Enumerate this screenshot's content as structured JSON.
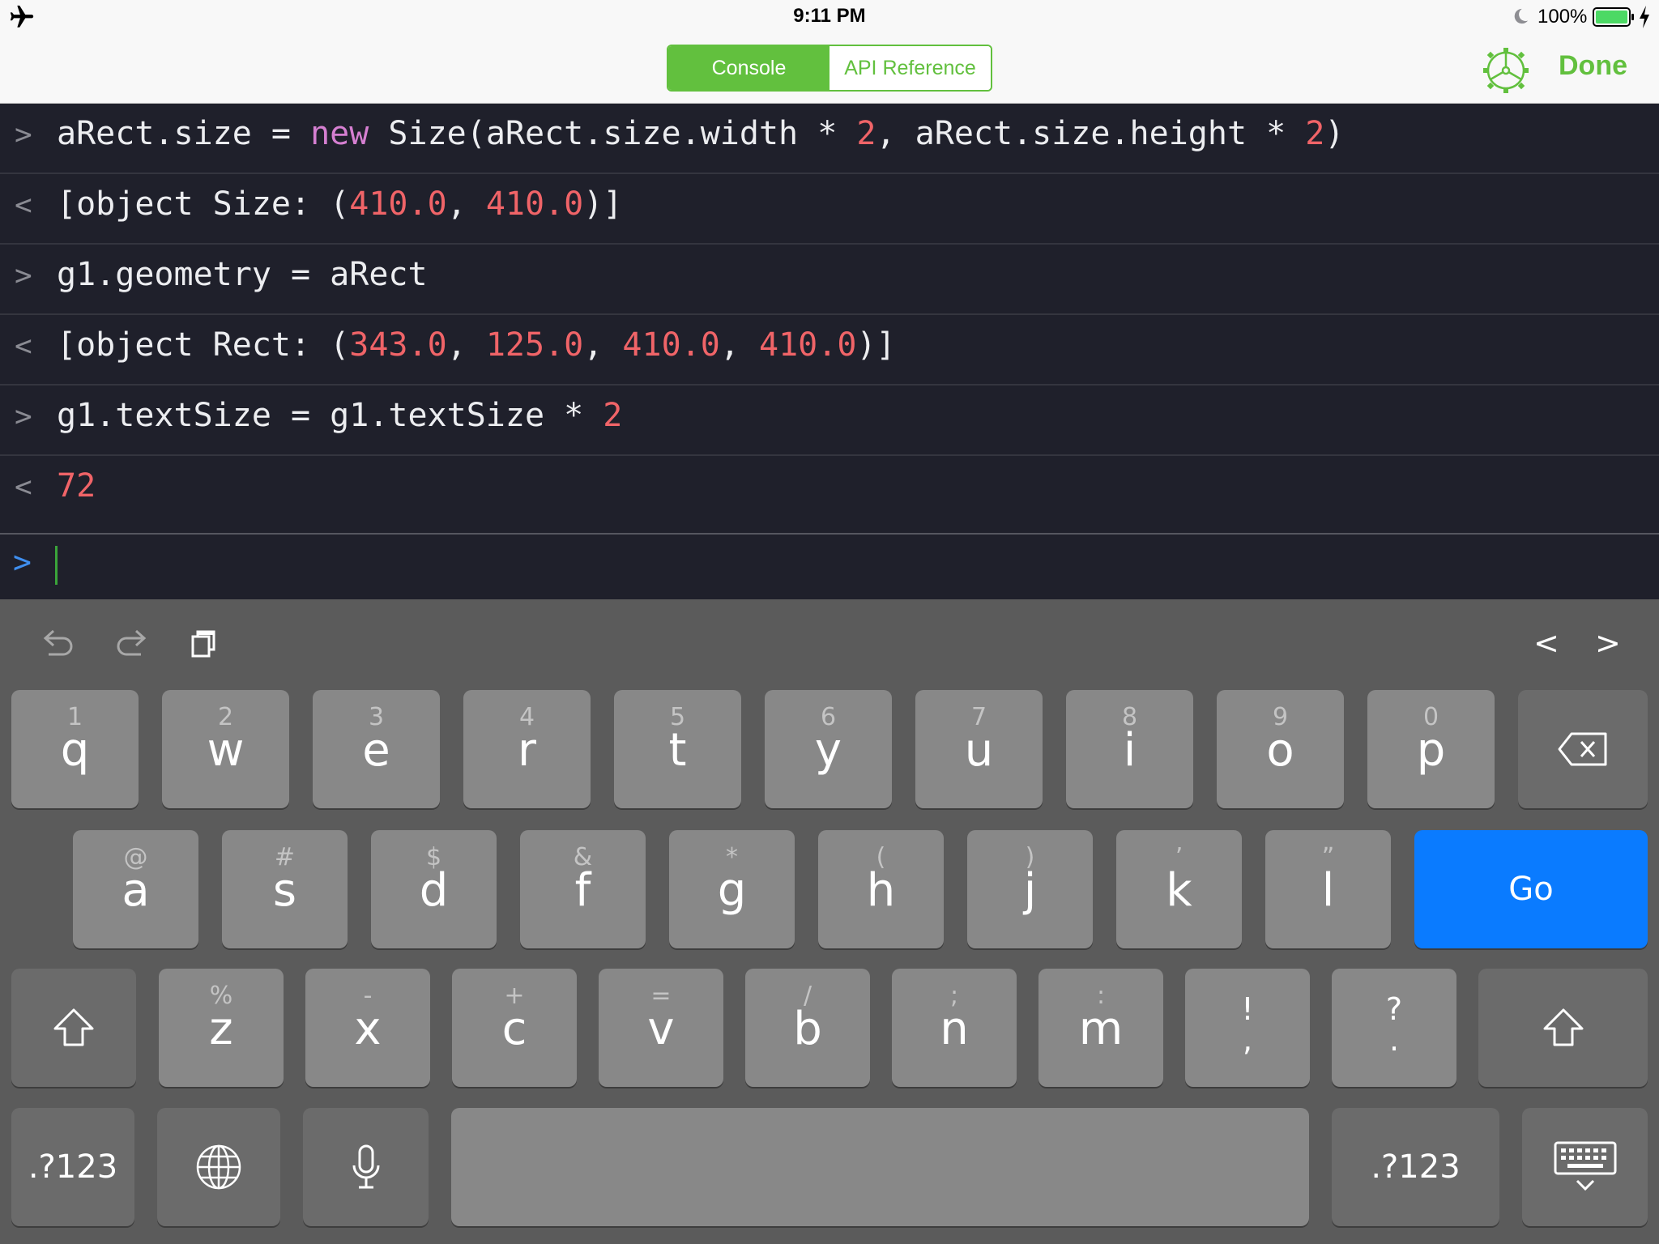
{
  "status_bar": {
    "time": "9:11 PM",
    "battery_percent": "100%",
    "airplane_mode": true,
    "do_not_disturb": true,
    "charging": true
  },
  "nav": {
    "tabs": [
      {
        "label": "Console",
        "selected": true
      },
      {
        "label": "API Reference",
        "selected": false
      }
    ],
    "settings_icon": "gear-icon",
    "done_label": "Done"
  },
  "console": {
    "lines": [
      {
        "marker": ">",
        "kind": "input",
        "tokens": [
          {
            "t": "aRect.size = ",
            "c": "txt"
          },
          {
            "t": "new",
            "c": "kw"
          },
          {
            "t": " Size(aRect.size.width * ",
            "c": "txt"
          },
          {
            "t": "2",
            "c": "num"
          },
          {
            "t": ", aRect.size.height * ",
            "c": "txt"
          },
          {
            "t": "2",
            "c": "num"
          },
          {
            "t": ")",
            "c": "txt"
          }
        ]
      },
      {
        "marker": "<",
        "kind": "output",
        "tokens": [
          {
            "t": "[object Size: (",
            "c": "txt"
          },
          {
            "t": "410.0",
            "c": "num"
          },
          {
            "t": ", ",
            "c": "txt"
          },
          {
            "t": "410.0",
            "c": "num"
          },
          {
            "t": ")]",
            "c": "txt"
          }
        ]
      },
      {
        "marker": ">",
        "kind": "input",
        "tokens": [
          {
            "t": "g1.geometry = aRect",
            "c": "txt"
          }
        ]
      },
      {
        "marker": "<",
        "kind": "output",
        "tokens": [
          {
            "t": "[object Rect: (",
            "c": "txt"
          },
          {
            "t": "343.0",
            "c": "num"
          },
          {
            "t": ", ",
            "c": "txt"
          },
          {
            "t": "125.0",
            "c": "num"
          },
          {
            "t": ", ",
            "c": "txt"
          },
          {
            "t": "410.0",
            "c": "num"
          },
          {
            "t": ", ",
            "c": "txt"
          },
          {
            "t": "410.0",
            "c": "num"
          },
          {
            "t": ")]",
            "c": "txt"
          }
        ]
      },
      {
        "marker": ">",
        "kind": "input",
        "tokens": [
          {
            "t": "g1.textSize = g1.textSize * ",
            "c": "txt"
          },
          {
            "t": "2",
            "c": "num"
          }
        ]
      },
      {
        "marker": "<",
        "kind": "output",
        "tokens": [
          {
            "t": "72",
            "c": "num"
          }
        ]
      }
    ],
    "prompt_marker": ">",
    "input_value": ""
  },
  "colors": {
    "accent_green": "#62c03e",
    "console_bg": "#1f202b",
    "number": "#f06468",
    "keyword": "#d57fd1",
    "prompt_blue": "#3f8ff0",
    "go_blue": "#0a7bff"
  },
  "keyboard": {
    "toolbar": {
      "undo_icon": "undo-icon",
      "redo_icon": "redo-icon",
      "paste_icon": "paste-icon",
      "prev_label": "<",
      "next_label": ">"
    },
    "row1": [
      {
        "alt": "1",
        "main": "q"
      },
      {
        "alt": "2",
        "main": "w"
      },
      {
        "alt": "3",
        "main": "e"
      },
      {
        "alt": "4",
        "main": "r"
      },
      {
        "alt": "5",
        "main": "t"
      },
      {
        "alt": "6",
        "main": "y"
      },
      {
        "alt": "7",
        "main": "u"
      },
      {
        "alt": "8",
        "main": "i"
      },
      {
        "alt": "9",
        "main": "o"
      },
      {
        "alt": "0",
        "main": "p"
      }
    ],
    "row2": [
      {
        "alt": "@",
        "main": "a"
      },
      {
        "alt": "#",
        "main": "s"
      },
      {
        "alt": "$",
        "main": "d"
      },
      {
        "alt": "&",
        "main": "f"
      },
      {
        "alt": "*",
        "main": "g"
      },
      {
        "alt": "(",
        "main": "h"
      },
      {
        "alt": ")",
        "main": "j"
      },
      {
        "alt": "’",
        "main": "k"
      },
      {
        "alt": "”",
        "main": "l"
      }
    ],
    "go_label": "Go",
    "row3": [
      {
        "alt": "%",
        "main": "z"
      },
      {
        "alt": "-",
        "main": "x"
      },
      {
        "alt": "+",
        "main": "c"
      },
      {
        "alt": "=",
        "main": "v"
      },
      {
        "alt": "/",
        "main": "b"
      },
      {
        "alt": ";",
        "main": "n"
      },
      {
        "alt": ":",
        "main": "m"
      }
    ],
    "punct_keys": [
      {
        "top": "!",
        "bottom": ","
      },
      {
        "top": "?",
        "bottom": "."
      }
    ],
    "numbers_label": ".?123",
    "icons": {
      "delete": "delete-icon",
      "shift": "shift-icon",
      "globe": "globe-icon",
      "mic": "microphone-icon",
      "dismiss": "keyboard-dismiss-icon"
    }
  }
}
